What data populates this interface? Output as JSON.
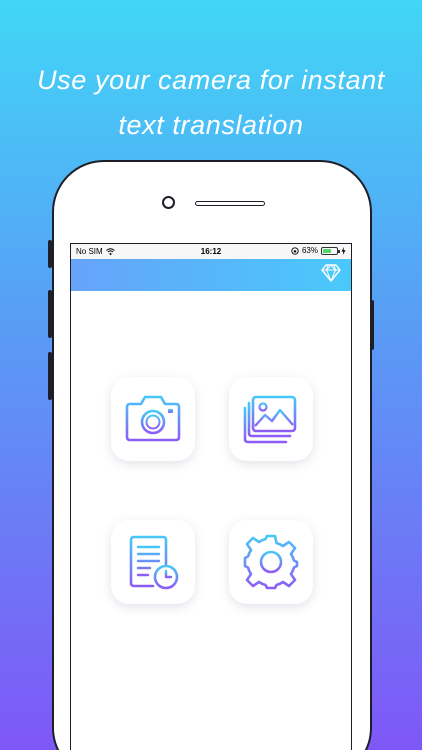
{
  "headline": {
    "line1": "Use your camera for instant",
    "line2": "text translation"
  },
  "status_bar": {
    "carrier": "No SIM",
    "time": "16:12",
    "battery_percent_text": "63%",
    "battery_level": 0.63
  },
  "nav": {
    "premium_icon": "diamond-icon"
  },
  "tiles": [
    {
      "icon": "camera-icon"
    },
    {
      "icon": "gallery-icon"
    },
    {
      "icon": "history-document-icon"
    },
    {
      "icon": "settings-gear-icon"
    }
  ],
  "colors": {
    "gradient_top": "#41d6f7",
    "gradient_bottom": "#7f57f7",
    "icon_gradient_start": "#47c7f7",
    "icon_gradient_end": "#8d5cf6"
  }
}
